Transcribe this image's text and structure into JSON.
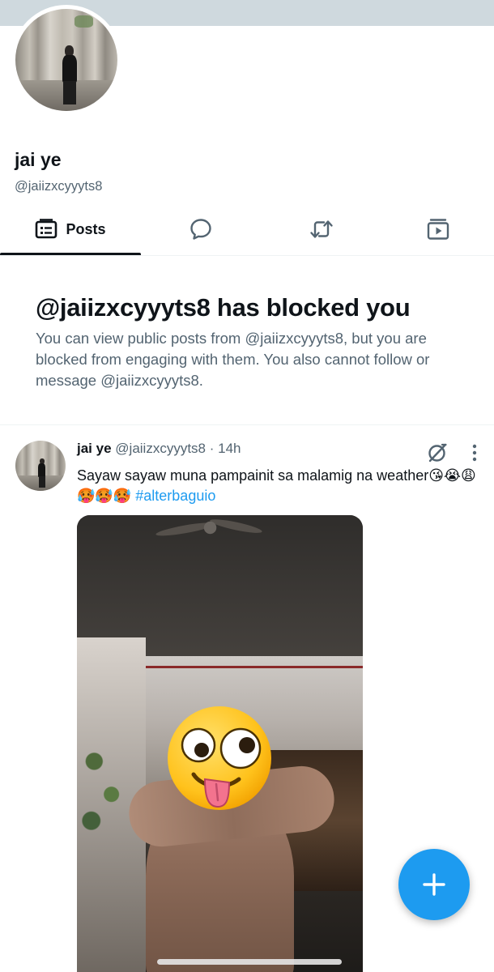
{
  "profile": {
    "display_name": "jai ye",
    "handle": "@jaiizxcyyyts8"
  },
  "tabs": [
    {
      "label": "Posts",
      "icon": "posts-icon",
      "selected": true
    },
    {
      "label": "",
      "icon": "reply-icon",
      "selected": false
    },
    {
      "label": "",
      "icon": "repost-icon",
      "selected": false
    },
    {
      "label": "",
      "icon": "media-icon",
      "selected": false
    }
  ],
  "blocked_notice": {
    "title": "@jaiizxcyyyts8 has blocked you",
    "description": "You can view public posts from @jaiizxcyyyts8, but you are blocked from engaging with them. You also cannot follow or message @jaiizxcyyyts8."
  },
  "post": {
    "author_name": "jai ye",
    "author_handle": "@jaiizxcyyyts8",
    "separator": " · ",
    "time": "14h",
    "text": "Sayaw sayaw muna pampainit sa malamig na weather😘😭😩🥵🥵🥵",
    "hashtag": "#alterbaguio",
    "media_type": "video",
    "media_overlay_emoji": "zany-face"
  },
  "fab": {
    "icon": "plus-icon"
  },
  "colors": {
    "accent": "#1d9bf0",
    "text_primary": "#0f1419",
    "text_secondary": "#536471",
    "banner": "#cfd9de"
  }
}
